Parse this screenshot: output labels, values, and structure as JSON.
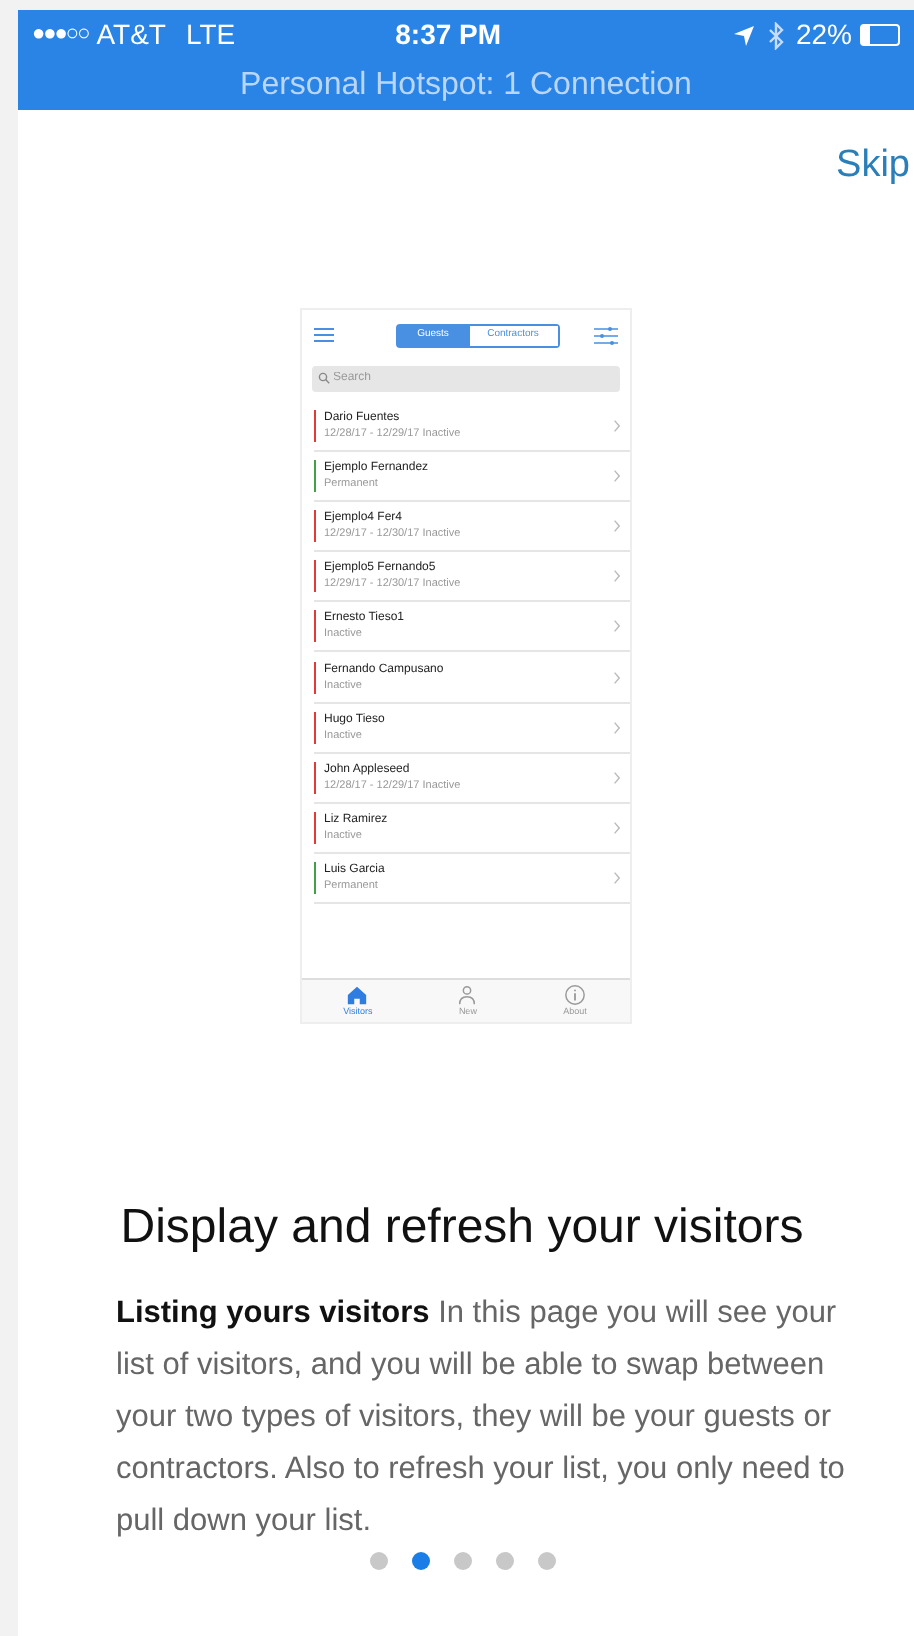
{
  "status_bar": {
    "signal": "●●●○○",
    "carrier": "AT&T",
    "network": "LTE",
    "time": "8:37 PM",
    "battery": "22%",
    "hotspot": "Personal Hotspot: 1 Connection"
  },
  "skip": "Skip",
  "preview": {
    "segments": [
      {
        "label": "Guests",
        "selected": true
      },
      {
        "label": "Contractors",
        "selected": false
      }
    ],
    "search": {
      "placeholder": "Search"
    },
    "rows": [
      {
        "name": "Dario Fuentes",
        "detail": "12/28/17 - 12/29/17 Inactive",
        "color": "#e53935"
      },
      {
        "name": "Ejemplo Fernandez",
        "detail": "Permanent",
        "color": "#43a047"
      },
      {
        "name": "Ejemplo4 Fer4",
        "detail": "12/29/17 - 12/30/17 Inactive",
        "color": "#e53935"
      },
      {
        "name": "Ejemplo5 Fernando5",
        "detail": "12/29/17 - 12/30/17 Inactive",
        "color": "#e53935"
      },
      {
        "name": "Ernesto Tieso1",
        "detail": "Inactive",
        "color": "#e53935"
      },
      {
        "name": "Fernando Campusano",
        "detail": "Inactive",
        "color": "#e53935"
      },
      {
        "name": "Hugo Tieso",
        "detail": "Inactive",
        "color": "#e53935"
      },
      {
        "name": "John Appleseed",
        "detail": "12/28/17 - 12/29/17 Inactive",
        "color": "#e53935"
      },
      {
        "name": "Liz Ramirez",
        "detail": "Inactive",
        "color": "#e53935"
      },
      {
        "name": "Luis Garcia",
        "detail": "Permanent",
        "color": "#43a047"
      }
    ],
    "tabs": [
      {
        "label": "Visitors",
        "kind": "home",
        "selected": true
      },
      {
        "label": "New",
        "kind": "person",
        "selected": false
      },
      {
        "label": "About",
        "kind": "info",
        "selected": false
      }
    ]
  },
  "title": "Display and refresh your visitors",
  "description": "**Listing yours visitors** In this page you will see your list of visitors, and you will be able to swap between your two types of visitors, they will be your guests or contractors. Also to refresh your list, you only need to pull down your list.",
  "pages": [
    {
      "selected": false
    },
    {
      "selected": true
    },
    {
      "selected": false
    },
    {
      "selected": false
    },
    {
      "selected": false
    }
  ]
}
